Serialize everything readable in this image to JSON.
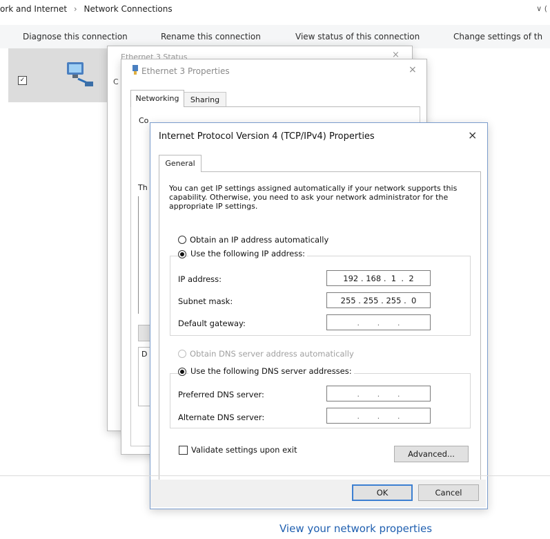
{
  "explorer": {
    "breadcrumb": [
      "ork and Internet",
      "Network Connections"
    ],
    "breadcrumb_separator": "›",
    "top_right": "∨ (",
    "commands": [
      "Diagnose this connection",
      "Rename this connection",
      "View status of this connection",
      "Change settings of th"
    ],
    "tile_check": "✓",
    "bottom_link": "View your network properties"
  },
  "status_window": {
    "title": "Ethernet 3 Status",
    "close": "×",
    "label_c": "C"
  },
  "ethernet_properties": {
    "title": "Ethernet 3 Properties",
    "close": "×",
    "tabs": [
      "Networking",
      "Sharing"
    ],
    "connect_using_partial": "Co",
    "this_connection_partial": "Th",
    "description_partial": "D"
  },
  "ipv4_dialog": {
    "title": "Internet Protocol Version 4 (TCP/IPv4) Properties",
    "close": "×",
    "tab": "General",
    "description": "You can get IP settings assigned automatically if your network supports this capability. Otherwise, you need to ask your network administrator for the appropriate IP settings.",
    "ip_auto_label": "Obtain an IP address automatically",
    "ip_manual_label": "Use the following IP address:",
    "ip_address_label": "IP address:",
    "ip_address_value": "192 . 168 .  1  .  2",
    "subnet_label": "Subnet mask:",
    "subnet_value": "255 . 255 . 255 .  0",
    "gateway_label": "Default gateway:",
    "gateway_value": " .       .       . ",
    "dns_auto_label": "Obtain DNS server address automatically",
    "dns_manual_label": "Use the following DNS server addresses:",
    "preferred_dns_label": "Preferred DNS server:",
    "preferred_dns_value": " .       .       . ",
    "alternate_dns_label": "Alternate DNS server:",
    "alternate_dns_value": " .       .       . ",
    "validate_label": "Validate settings upon exit",
    "advanced_button": "Advanced...",
    "ok_button": "OK",
    "cancel_button": "Cancel",
    "ip_mode": "manual",
    "dns_mode": "manual",
    "validate_checked": false
  },
  "colors": {
    "link": "#1f5fb0",
    "dialog_border": "#7a9ccc",
    "ok_focus": "#3c7fd1"
  }
}
